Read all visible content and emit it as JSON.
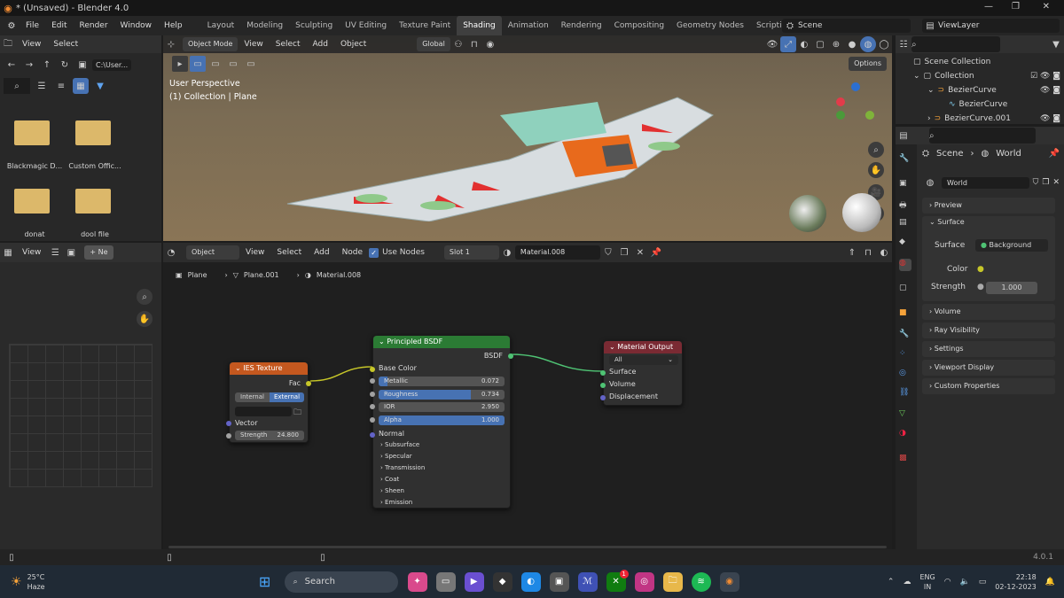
{
  "window": {
    "title": "* (Unsaved) - Blender 4.0"
  },
  "menu": [
    "File",
    "Edit",
    "Render",
    "Window",
    "Help"
  ],
  "workspaces": [
    "Layout",
    "Modeling",
    "Sculpting",
    "UV Editing",
    "Texture Paint",
    "Shading",
    "Animation",
    "Rendering",
    "Compositing",
    "Geometry Nodes",
    "Scripting"
  ],
  "active_workspace": "Shading",
  "scene_field": "Scene",
  "viewlayer_field": "ViewLayer",
  "filebrowser": {
    "view": "View",
    "select": "Select",
    "path": "C:\\User...",
    "items": [
      "Blackmagic D...",
      "Custom Offic...",
      "donat",
      "dool file"
    ]
  },
  "viewport": {
    "mode": "Object Mode",
    "menus": [
      "View",
      "Select",
      "Add",
      "Object"
    ],
    "transform": "Global",
    "options": "Options",
    "info1": "User Perspective",
    "info2": "(1) Collection | Plane"
  },
  "image_editor": {
    "view": "View",
    "new": "Ne"
  },
  "node_editor": {
    "type": "Object",
    "menus": [
      "View",
      "Select",
      "Add",
      "Node"
    ],
    "use_nodes": "Use Nodes",
    "slot": "Slot 1",
    "material": "Material.008",
    "breadcrumb": [
      "Plane",
      "Plane.001",
      "Material.008"
    ]
  },
  "nodes": {
    "ies": {
      "title": "IES Texture",
      "fac": "Fac",
      "internal": "Internal",
      "external": "External",
      "vector": "Vector",
      "strength_label": "Strength",
      "strength": "24.800"
    },
    "bsdf": {
      "title": "Principled BSDF",
      "out": "BSDF",
      "base_color": "Base Color",
      "fields": [
        {
          "label": "Metallic",
          "value": "0.072",
          "fill": 0.072
        },
        {
          "label": "Roughness",
          "value": "0.734",
          "fill": 0.734
        },
        {
          "label": "IOR",
          "value": "2.950",
          "fill": 0
        },
        {
          "label": "Alpha",
          "value": "1.000",
          "fill": 1
        }
      ],
      "normal": "Normal",
      "panels": [
        "Subsurface",
        "Specular",
        "Transmission",
        "Coat",
        "Sheen",
        "Emission"
      ]
    },
    "output": {
      "title": "Material Output",
      "target": "All",
      "inputs": [
        "Surface",
        "Volume",
        "Displacement"
      ]
    }
  },
  "outliner": {
    "scene_collection": "Scene Collection",
    "items": [
      "Collection",
      "BezierCurve",
      "BezierCurve",
      "BezierCurve.001"
    ]
  },
  "properties": {
    "breadcrumb_scene": "Scene",
    "breadcrumb_world": "World",
    "world_name": "World",
    "preview": "Preview",
    "surface_header": "Surface",
    "surface_label": "Surface",
    "surface_value": "Background",
    "color_label": "Color",
    "strength_label": "Strength",
    "strength_value": "1.000",
    "sections": [
      "Volume",
      "Ray Visibility",
      "Settings",
      "Viewport Display",
      "Custom Properties"
    ]
  },
  "status": {
    "version": "4.0.1"
  },
  "taskbar": {
    "weather_temp": "25°C",
    "weather_desc": "Haze",
    "search": "Search",
    "lang1": "ENG",
    "lang2": "IN",
    "time": "22:18",
    "date": "02-12-2023",
    "badge": "1"
  }
}
